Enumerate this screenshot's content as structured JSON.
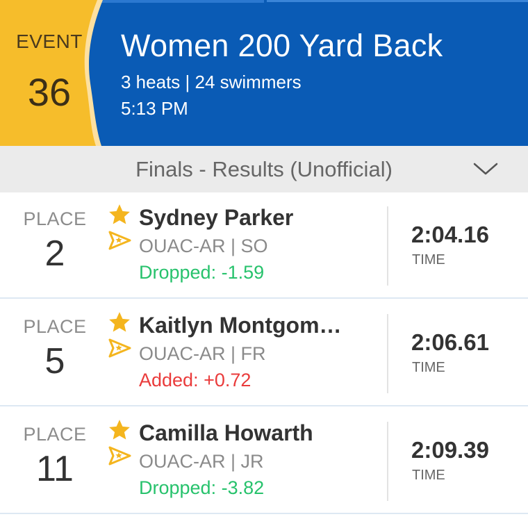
{
  "event": {
    "label": "EVENT",
    "number": "36",
    "title": "Women 200 Yard Back",
    "meta": "3 heats | 24 swimmers",
    "time": "5:13 PM"
  },
  "results_header": {
    "title": "Finals - Results (Unofficial)",
    "toggle_icon": "chevron-down-icon"
  },
  "rows": [
    {
      "place_label": "PLACE",
      "place": "2",
      "name": "Sydney Parker",
      "team": "OUAC-AR | SO",
      "delta": "Dropped: -1.59",
      "delta_type": "dropped",
      "time": "2:04.16",
      "time_label": "TIME"
    },
    {
      "place_label": "PLACE",
      "place": "5",
      "name": "Kaitlyn Montgom…",
      "team": "OUAC-AR | FR",
      "delta": "Added: +0.72",
      "delta_type": "added",
      "time": "2:06.61",
      "time_label": "TIME"
    },
    {
      "place_label": "PLACE",
      "place": "11",
      "name": "Camilla Howarth",
      "team": "OUAC-AR | JR",
      "delta": "Dropped: -3.82",
      "delta_type": "dropped",
      "time": "2:09.39",
      "time_label": "TIME"
    }
  ],
  "icons": {
    "favorite": "star-icon",
    "team_badge": "team-badge-icon"
  },
  "colors": {
    "header_blue": "#0a5bb5",
    "event_yellow": "#f6bd2b",
    "dropped_green": "#27c26c",
    "added_red": "#ea3b3b",
    "star_gold": "#f4b51e"
  }
}
